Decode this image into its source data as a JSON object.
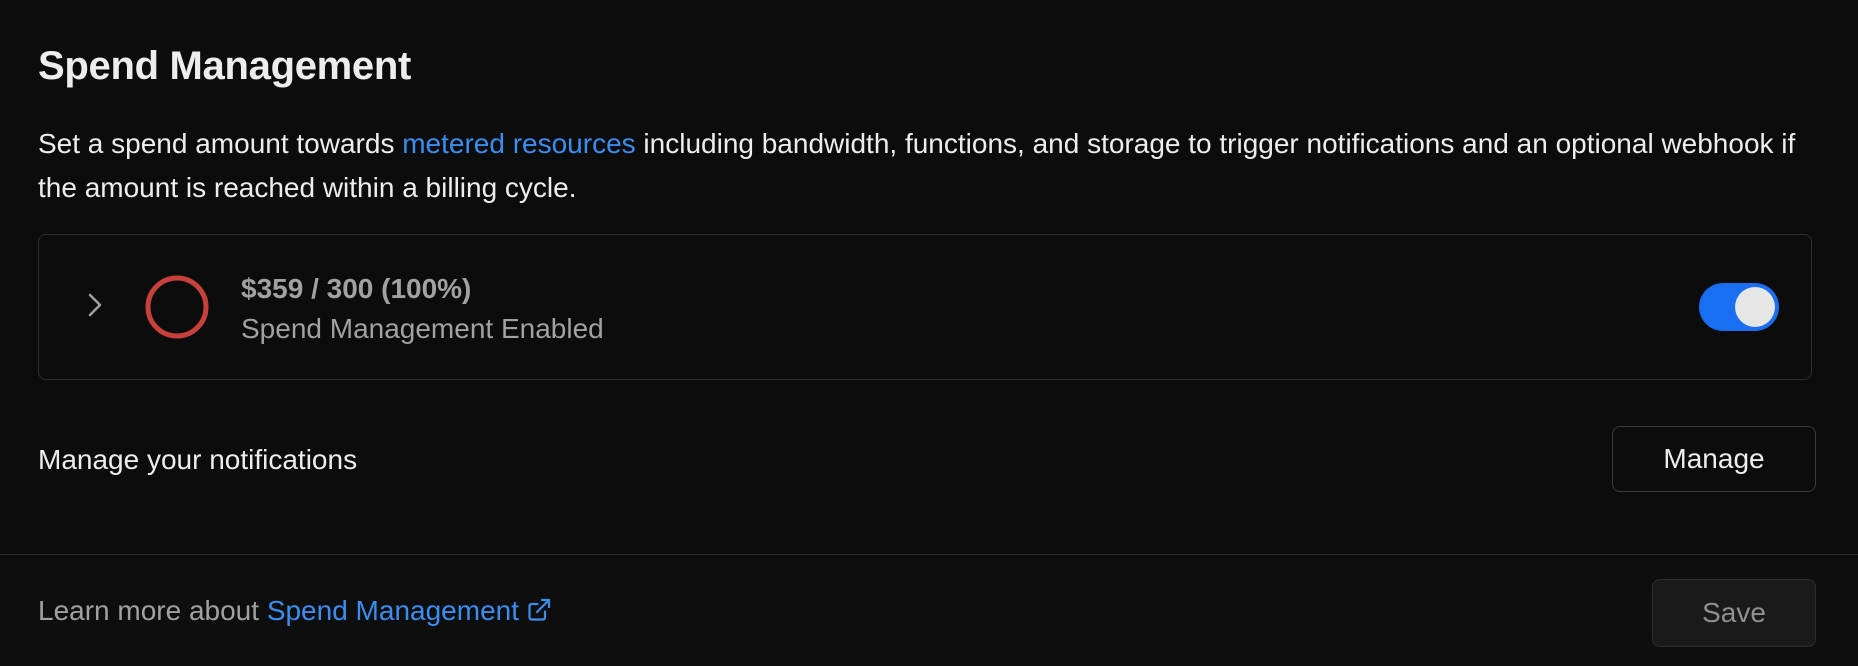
{
  "header": {
    "title": "Spend Management"
  },
  "description": {
    "before_link": "Set a spend amount towards ",
    "link_text": "metered resources",
    "after_link": " including bandwidth, functions, and storage to trigger notifications and an optional webhook if the amount is reached within a billing cycle."
  },
  "spend": {
    "amount_text": "$359 / 300 (100%)",
    "status_text": "Spend Management Enabled",
    "usage_fraction": 1.0,
    "ring_color": "#c8403b",
    "toggle_on": true,
    "toggle_color": "#1a6ef2"
  },
  "notifications": {
    "label": "Manage your notifications",
    "manage_label": "Manage"
  },
  "footer": {
    "learn_more_prefix": "Learn more about ",
    "learn_more_link": "Spend Management",
    "save_label": "Save"
  },
  "colors": {
    "background": "#0c0c0c",
    "link": "#3b8ef0",
    "muted_text": "#a1a1a1"
  },
  "icons": {
    "chevron": "chevron-right-icon",
    "external": "external-link-icon"
  }
}
